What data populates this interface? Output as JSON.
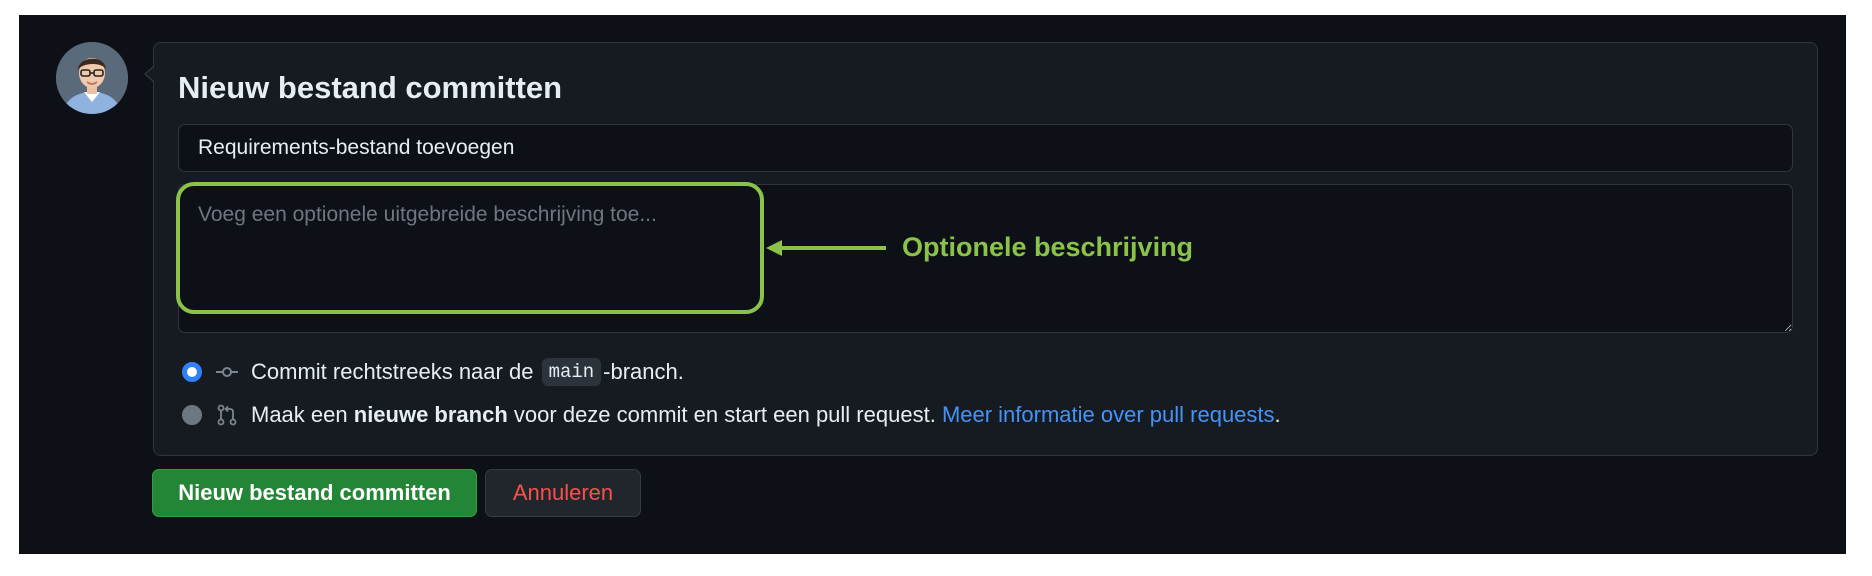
{
  "form": {
    "title": "Nieuw bestand committen",
    "summary_value": "Requirements-bestand toevoegen",
    "description_placeholder": "Voeg een optionele uitgebreide beschrijving toe..."
  },
  "annotation": {
    "label": "Optionele beschrijving",
    "color": "#8bc34a"
  },
  "options": [
    {
      "selected": true,
      "icon": "git-commit-icon",
      "prefix": "Commit rechtstreeks naar de",
      "branch_code": "main",
      "suffix": "-branch."
    },
    {
      "selected": false,
      "icon": "git-pull-request-icon",
      "prefix": "Maak een",
      "bold": "nieuwe branch",
      "middle": "voor deze commit en start een pull request.",
      "link": "Meer informatie over pull requests",
      "suffix": "."
    }
  ],
  "buttons": {
    "commit": "Nieuw bestand committen",
    "cancel": "Annuleren"
  },
  "colors": {
    "background": "#0d1117",
    "card": "#161b22",
    "primary_button": "#238636",
    "danger_text": "#f85149",
    "link": "#4493f8",
    "radio_selected": "#2f81f7"
  },
  "icons": {
    "avatar": "user-avatar"
  }
}
